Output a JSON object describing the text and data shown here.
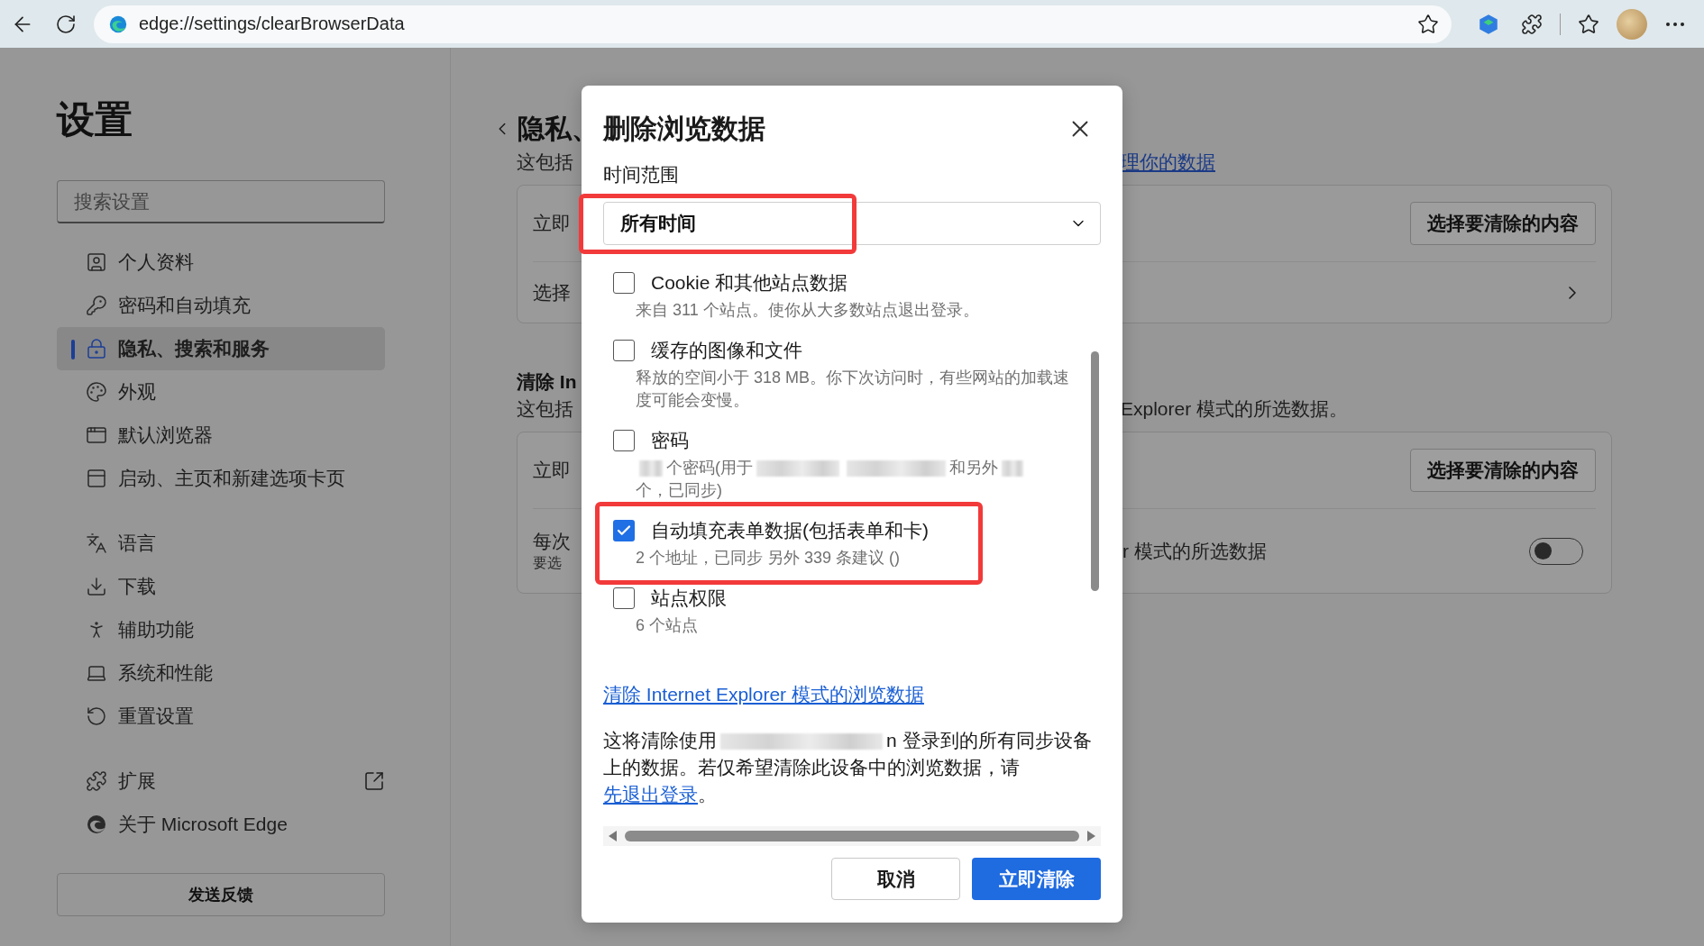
{
  "toolbar": {
    "url": "edge://settings/clearBrowserData"
  },
  "sidebar": {
    "title": "设置",
    "search": {
      "placeholder": "搜索设置"
    },
    "groups": [
      {
        "items": [
          {
            "label": "个人资料",
            "selected": false,
            "kind": "page"
          },
          {
            "label": "密码和自动填充",
            "selected": false,
            "kind": "page"
          },
          {
            "label": "隐私、搜索和服务",
            "selected": true,
            "kind": "page"
          },
          {
            "label": "外观",
            "selected": false,
            "kind": "page"
          },
          {
            "label": "默认浏览器",
            "selected": false,
            "kind": "page"
          },
          {
            "label": "启动、主页和新建选项卡页",
            "selected": false,
            "kind": "page"
          }
        ]
      },
      {
        "items": [
          {
            "label": "语言",
            "selected": false,
            "kind": "page"
          },
          {
            "label": "下载",
            "selected": false,
            "kind": "page"
          },
          {
            "label": "辅助功能",
            "selected": false,
            "kind": "page"
          },
          {
            "label": "系统和性能",
            "selected": false,
            "kind": "page"
          },
          {
            "label": "重置设置",
            "selected": false,
            "kind": "page"
          }
        ]
      },
      {
        "items": [
          {
            "label": "扩展",
            "selected": false,
            "kind": "external"
          },
          {
            "label": "关于 Microsoft Edge",
            "selected": false,
            "kind": "page"
          }
        ]
      }
    ],
    "feedback": "发送反馈"
  },
  "page": {
    "title": "隐私、",
    "subtitle": "这包括",
    "subtitle_link": "理你的数据",
    "card_1": [
      {
        "kind": "button",
        "label": "立即",
        "action": "选择要清除的内容"
      },
      {
        "kind": "chevron",
        "label": "选择"
      }
    ],
    "section_2": {
      "title": "清除 In",
      "subtitle": "这包括",
      "subtitle_tail": "Explorer 模式的所选数据。"
    },
    "card_2": [
      {
        "kind": "button",
        "label": "立即",
        "action": "选择要清除的内容"
      },
      {
        "kind": "toggle",
        "label": "每次",
        "hint": "要选",
        "tail": "r 模式的所选数据",
        "on": false
      }
    ]
  },
  "dialog": {
    "title": "删除浏览数据",
    "time_range": {
      "label": "时间范围",
      "value": "所有时间",
      "highlighted": true
    },
    "options": [
      {
        "label": "Cookie 和其他站点数据",
        "checked": false,
        "highlighted": false,
        "desc": [
          {
            "kind": "text",
            "text": "来自 311 个站点。使你从大多数站点退出登录。"
          }
        ]
      },
      {
        "label": "缓存的图像和文件",
        "checked": false,
        "highlighted": false,
        "desc": [
          {
            "kind": "text",
            "text": "释放的空间小于 318 MB。你下次访问时，有些网站的加载速度可能会变慢。"
          }
        ]
      },
      {
        "label": "密码",
        "checked": false,
        "highlighted": false,
        "desc": [
          {
            "kind": "redacted"
          },
          {
            "kind": "text",
            "text": "个密码(用于"
          },
          {
            "kind": "redacted"
          },
          {
            "kind": "redacted"
          },
          {
            "kind": "text",
            "text": "和另外"
          },
          {
            "kind": "redacted"
          },
          {
            "kind": "text",
            "text": "个，已同"
          },
          {
            "kind": "text",
            "text": "步)"
          }
        ]
      },
      {
        "label": "自动填充表单数据(包括表单和卡)",
        "checked": true,
        "highlighted": true,
        "desc": [
          {
            "kind": "text",
            "text": "2 个地址，已同步 另外 339 条建议 ()"
          }
        ]
      },
      {
        "label": "站点权限",
        "checked": false,
        "highlighted": false,
        "desc": [
          {
            "kind": "text",
            "text": "6 个站点"
          }
        ]
      }
    ],
    "ie_link": "清除 Internet Explorer 模式的浏览数据",
    "sync_note": [
      {
        "kind": "text",
        "text": "这将清除使用"
      },
      {
        "kind": "redacted"
      },
      {
        "kind": "text",
        "text": "n 登录到的所有同步设备"
      },
      {
        "kind": "text",
        "text": "上的数据。若仅希望清除此设备中的浏览数据，请"
      },
      {
        "kind": "link",
        "text": "先退出登录"
      },
      {
        "kind": "text",
        "text": "。"
      }
    ],
    "buttons": [
      {
        "label": "取消",
        "kind": "secondary"
      },
      {
        "label": "立即清除",
        "kind": "primary"
      }
    ]
  }
}
